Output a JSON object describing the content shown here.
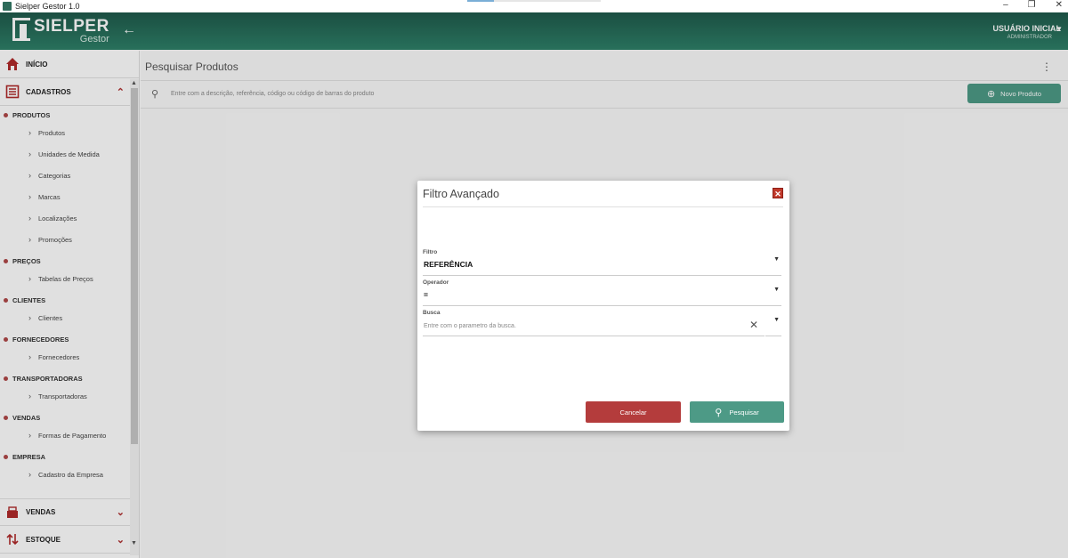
{
  "window": {
    "title": "Sielper Gestor 1.0",
    "minimize": "–",
    "restore": "❐",
    "close": "✕"
  },
  "header": {
    "brand": "SIELPER",
    "brand_sub": "Gestor",
    "back_icon": "arrow-left-icon",
    "user_name": "USUÁRIO INICIAL",
    "user_role": "ADMINISTRADOR"
  },
  "sidebar": {
    "home": "INÍCIO",
    "cadastros": "CADASTROS",
    "groups": [
      {
        "label": "PRODUTOS",
        "items": [
          "Produtos",
          "Unidades de Medida",
          "Categorias",
          "Marcas",
          "Localizações",
          "Promoções"
        ]
      },
      {
        "label": "PREÇOS",
        "items": [
          "Tabelas de Preços"
        ]
      },
      {
        "label": "CLIENTES",
        "items": [
          "Clientes"
        ]
      },
      {
        "label": "FORNECEDORES",
        "items": [
          "Fornecedores"
        ]
      },
      {
        "label": "TRANSPORTADORAS",
        "items": [
          "Transportadoras"
        ]
      },
      {
        "label": "VENDAS",
        "items": [
          "Formas de Pagamento"
        ]
      },
      {
        "label": "EMPRESA",
        "items": [
          "Cadastro da Empresa"
        ]
      }
    ],
    "vendas": "VENDAS",
    "estoque": "ESTOQUE"
  },
  "main": {
    "title": "Pesquisar Produtos",
    "search_placeholder": "Entre com a descrição, referência, código ou código de barras do produto",
    "new_button": "Novo Produto"
  },
  "modal": {
    "title": "Filtro Avançado",
    "filtro_label": "Filtro",
    "filtro_value": "REFERÊNCIA",
    "operador_label": "Operador",
    "operador_value": "=",
    "busca_label": "Busca",
    "busca_placeholder": "Entre com o parametro da busca.",
    "cancel": "Cancelar",
    "search": "Pesquisar"
  },
  "colors": {
    "header": "#2e8068",
    "accent_red": "#b43c3c",
    "accent_green": "#4d9a86"
  }
}
